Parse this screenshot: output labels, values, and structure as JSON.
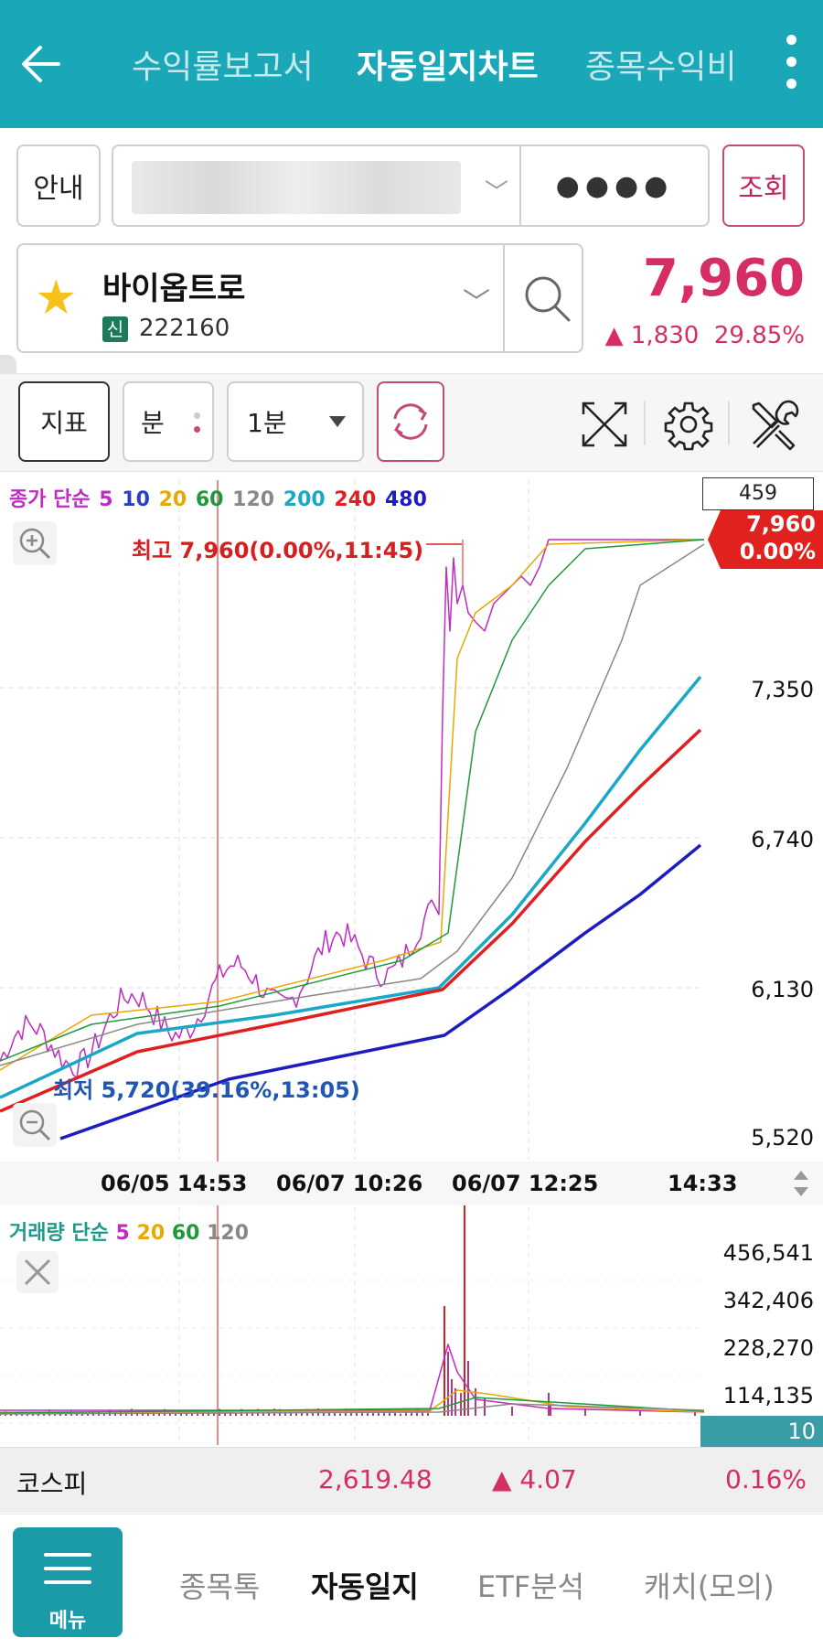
{
  "header": {
    "tabs": [
      {
        "label": "수익률보고서",
        "active": false
      },
      {
        "label": "자동일지차트",
        "active": true
      },
      {
        "label": "종목수익비",
        "active": false
      }
    ]
  },
  "account": {
    "guide_label": "안내",
    "password_mask": "●●●●",
    "inquiry_label": "조회"
  },
  "stock": {
    "name": "바이옵트로",
    "badge": "신",
    "code": "222160",
    "price": "7,960",
    "change": "▲ 1,830",
    "change_pct": "29.85%"
  },
  "toolbar": {
    "indicator_label": "지표",
    "unit_label": "분",
    "interval_label": "1분"
  },
  "chart_legend": {
    "prefix": "종가 단순",
    "periods": [
      {
        "label": "5",
        "color": "#c02cc0"
      },
      {
        "label": "10",
        "color": "#2b3fc4"
      },
      {
        "label": "20",
        "color": "#e8a800"
      },
      {
        "label": "60",
        "color": "#1e9a3c"
      },
      {
        "label": "120",
        "color": "#888888"
      },
      {
        "label": "200",
        "color": "#19a8c8"
      },
      {
        "label": "240",
        "color": "#e02020"
      },
      {
        "label": "480",
        "color": "#1c1cc0"
      }
    ]
  },
  "volume_legend": {
    "prefix": "거래량 단순",
    "periods": [
      {
        "label": "5",
        "color": "#c02cc0"
      },
      {
        "label": "20",
        "color": "#e8a800"
      },
      {
        "label": "60",
        "color": "#1e9a3c"
      },
      {
        "label": "120",
        "color": "#888888"
      }
    ]
  },
  "chart_data": {
    "type": "line",
    "cursor_count": "459",
    "last_price": "7,960",
    "last_pct": "0.00%",
    "high_label": "최고 7,960(0.00%,11:45)",
    "low_label": "최저 5,720(39.16%,13:05)",
    "y_ticks": [
      "7,350",
      "6,740",
      "6,130",
      "5,520"
    ],
    "ylim": [
      5520,
      7960
    ],
    "x_ticks": [
      "06/05 14:53",
      "06/07 10:26",
      "06/07 12:25",
      "14:33"
    ],
    "volume_ticks": [
      "456,541",
      "342,406",
      "228,270",
      "114,135"
    ],
    "volume_last": "10"
  },
  "index": {
    "name": "코스피",
    "value": "2,619.48",
    "change": "▲ 4.07",
    "pct": "0.16%"
  },
  "bottom_nav": {
    "menu_label": "메뉴",
    "items": [
      {
        "label": "종목톡",
        "active": false
      },
      {
        "label": "자동일지",
        "active": true
      },
      {
        "label": "ETF분석",
        "active": false
      },
      {
        "label": "캐치(모의)",
        "active": false
      }
    ]
  }
}
